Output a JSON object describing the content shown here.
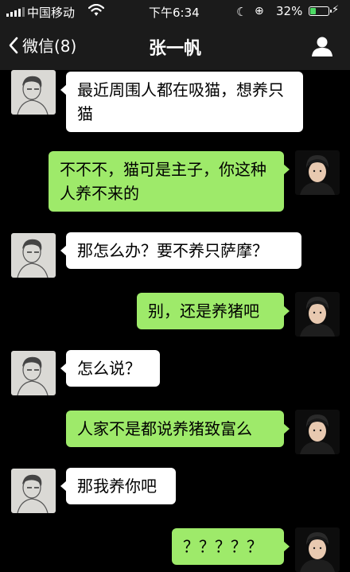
{
  "status_bar": {
    "carrier": "中国移动",
    "time": "下午6:34",
    "battery_percent": "32%",
    "battery_level": 0.32,
    "icons": [
      "signal-icon",
      "wifi-icon",
      "moon-icon",
      "orientation-lock-icon",
      "battery-icon",
      "charging-icon"
    ]
  },
  "nav": {
    "back_label": "微信(8)",
    "title": "张一帆",
    "icons": [
      "chevron-left-icon",
      "profile-icon"
    ]
  },
  "colors": {
    "outgoing_bubble": "#9eea6a",
    "incoming_bubble": "#ffffff",
    "background": "#000000",
    "bar": "#1b1b1b"
  },
  "messages": [
    {
      "from": "friend",
      "text": "最近周围人都在吸猫，想养只猫"
    },
    {
      "from": "me",
      "text": "不不不，猫可是主子，你这种人养不来的"
    },
    {
      "from": "friend",
      "text": "那怎么办？要不养只萨摩？"
    },
    {
      "from": "me",
      "text": "别，还是养猪吧"
    },
    {
      "from": "friend",
      "text": "怎么说？"
    },
    {
      "from": "me",
      "text": "人家不是都说养猪致富么"
    },
    {
      "from": "friend",
      "text": "那我养你吧"
    },
    {
      "from": "me",
      "text": "？？？？？"
    }
  ]
}
